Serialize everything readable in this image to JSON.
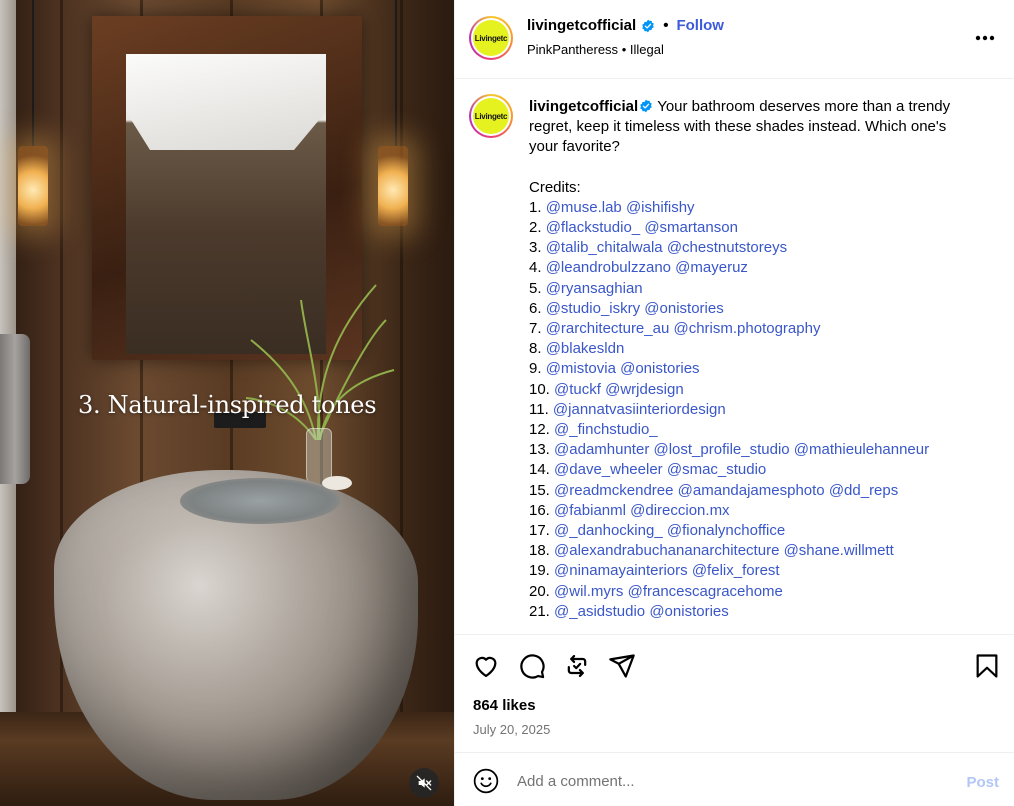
{
  "media": {
    "caption_overlay": "3. Natural-inspired tones",
    "mute_icon": "speaker-muted-icon"
  },
  "header": {
    "username": "livingetcofficial",
    "verified": true,
    "separator": "•",
    "follow_label": "Follow",
    "audio_artist": "PinkPantheress",
    "audio_separator": "•",
    "audio_track": "Illegal",
    "avatar_text": "Livingetc",
    "more_icon": "more-horizontal-icon"
  },
  "caption": {
    "username": "livingetcofficial",
    "text": "Your bathroom deserves more than a trendy regret, keep it timeless with these shades instead. Which one's your favorite?",
    "credits_title": "Credits:",
    "credits": [
      {
        "num": "1.",
        "mentions": [
          "@muse.lab",
          "@ishifishy"
        ]
      },
      {
        "num": "2.",
        "mentions": [
          "@flackstudio_",
          "@smartanson"
        ]
      },
      {
        "num": "3.",
        "mentions": [
          "@talib_chitalwala",
          "@chestnutstoreys"
        ]
      },
      {
        "num": "4.",
        "mentions": [
          "@leandrobulzzano",
          "@mayeruz"
        ]
      },
      {
        "num": "5.",
        "mentions": [
          "@ryansaghian"
        ]
      },
      {
        "num": "6.",
        "mentions": [
          "@studio_iskry",
          "@onistories"
        ]
      },
      {
        "num": "7.",
        "mentions": [
          "@rarchitecture_au",
          "@chrism.photography"
        ]
      },
      {
        "num": "8.",
        "mentions": [
          "@blakesldn"
        ]
      },
      {
        "num": "9.",
        "mentions": [
          "@mistovia",
          "@onistories"
        ]
      },
      {
        "num": "10.",
        "mentions": [
          "@tuckf",
          "@wrjdesign"
        ]
      },
      {
        "num": "11.",
        "mentions": [
          "@jannatvasiinteriordesign"
        ]
      },
      {
        "num": "12.",
        "mentions": [
          "@_finchstudio_"
        ]
      },
      {
        "num": "13.",
        "mentions": [
          "@adamhunter",
          "@lost_profile_studio",
          "@mathieulehanneur"
        ]
      },
      {
        "num": "14.",
        "mentions": [
          "@dave_wheeler",
          "@smac_studio"
        ]
      },
      {
        "num": "15.",
        "mentions": [
          "@readmckendree",
          "@amandajamesphoto",
          "@dd_reps"
        ]
      },
      {
        "num": "16.",
        "mentions": [
          "@fabianml",
          "@direccion.mx"
        ]
      },
      {
        "num": "17.",
        "mentions": [
          "@_danhocking_",
          "@fionalynchoffice"
        ]
      },
      {
        "num": "18.",
        "mentions": [
          "@alexandrabuchananarchitecture",
          "@shane.willmett"
        ]
      },
      {
        "num": "19.",
        "mentions": [
          "@ninamayainteriors",
          "@felix_forest"
        ]
      },
      {
        "num": "20.",
        "mentions": [
          "@wil.myrs",
          "@francescagracehome"
        ]
      },
      {
        "num": "21.",
        "mentions": [
          "@_asidstudio",
          "@onistories"
        ]
      }
    ]
  },
  "actions": {
    "like_icon": "heart-icon",
    "comment_icon": "comment-icon",
    "repost_icon": "repost-icon",
    "share_icon": "share-icon",
    "save_icon": "bookmark-icon"
  },
  "stats": {
    "likes": "864 likes",
    "date": "July 20, 2025"
  },
  "comment": {
    "emoji_icon": "emoji-icon",
    "placeholder": "Add a comment...",
    "post_label": "Post"
  },
  "colors": {
    "link": "#3a57c9",
    "verified": "#0095f6",
    "post_disabled": "#b3c6f8",
    "muted_text": "#737373"
  }
}
